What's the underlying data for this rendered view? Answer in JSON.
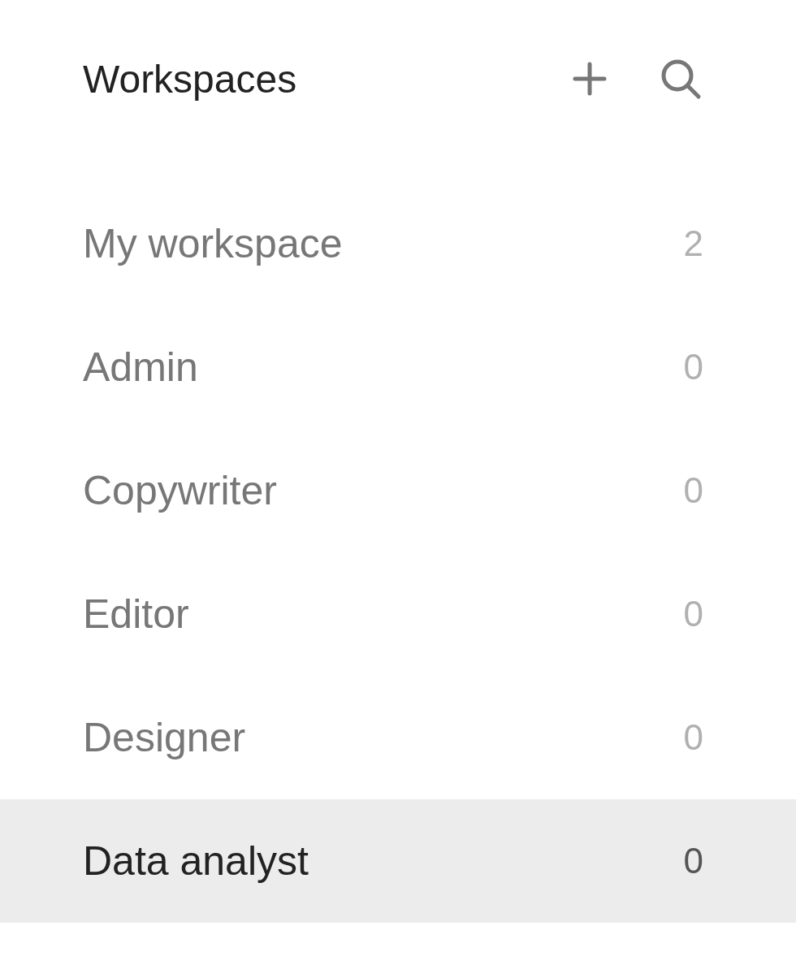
{
  "header": {
    "title": "Workspaces"
  },
  "workspaces": [
    {
      "name": "My workspace",
      "count": "2",
      "selected": false
    },
    {
      "name": "Admin",
      "count": "0",
      "selected": false
    },
    {
      "name": "Copywriter",
      "count": "0",
      "selected": false
    },
    {
      "name": "Editor",
      "count": "0",
      "selected": false
    },
    {
      "name": "Designer",
      "count": "0",
      "selected": false
    },
    {
      "name": "Data analyst",
      "count": "0",
      "selected": true
    }
  ]
}
